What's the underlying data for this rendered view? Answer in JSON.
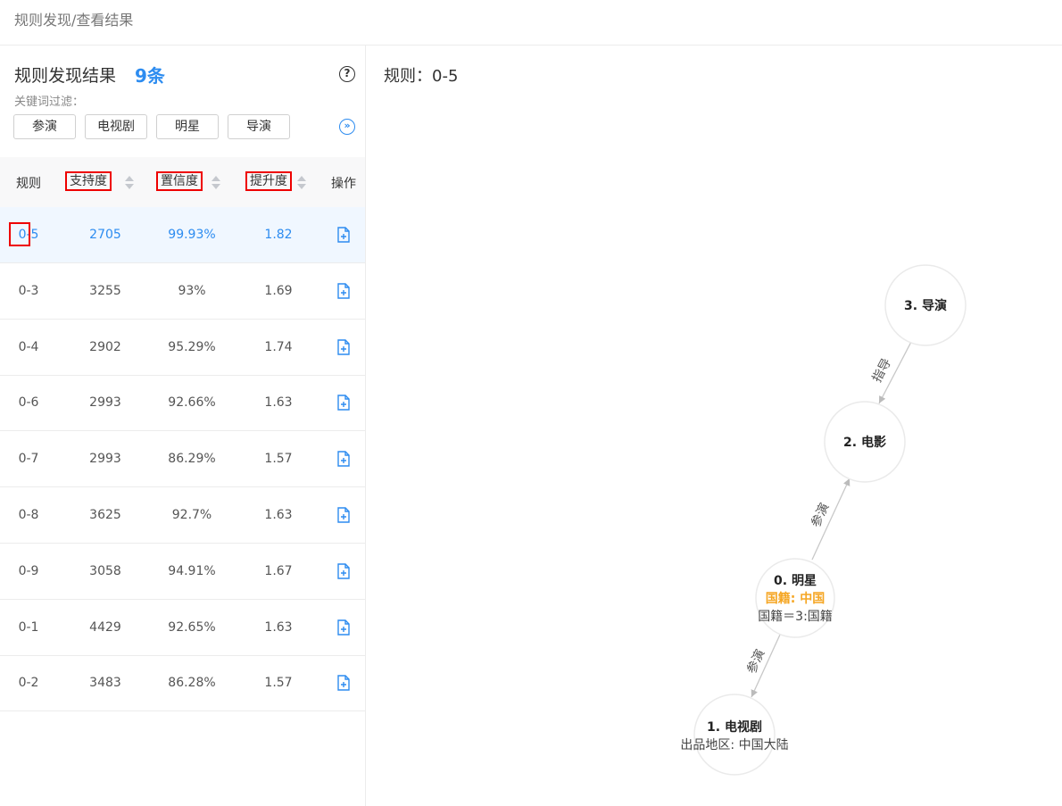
{
  "breadcrumb": "规则发现/查看结果",
  "left_panel": {
    "title": "规则发现结果",
    "count": "9条",
    "help_icon": "?",
    "filter_label": "关键词过滤：",
    "chips": [
      "参演",
      "电视剧",
      "明星",
      "导演"
    ],
    "expand_icon": "»"
  },
  "table": {
    "headers": {
      "rule": "规则",
      "support": "支持度",
      "confidence": "置信度",
      "lift": "提升度",
      "action": "操作"
    },
    "rows": [
      {
        "rule": "0-5",
        "support": "2705",
        "confidence": "99.93%",
        "lift": "1.82"
      },
      {
        "rule": "0-3",
        "support": "3255",
        "confidence": "93%",
        "lift": "1.69"
      },
      {
        "rule": "0-4",
        "support": "2902",
        "confidence": "95.29%",
        "lift": "1.74"
      },
      {
        "rule": "0-6",
        "support": "2993",
        "confidence": "92.66%",
        "lift": "1.63"
      },
      {
        "rule": "0-7",
        "support": "2993",
        "confidence": "86.29%",
        "lift": "1.57"
      },
      {
        "rule": "0-8",
        "support": "3625",
        "confidence": "92.7%",
        "lift": "1.63"
      },
      {
        "rule": "0-9",
        "support": "3058",
        "confidence": "94.91%",
        "lift": "1.67"
      },
      {
        "rule": "0-1",
        "support": "4429",
        "confidence": "92.65%",
        "lift": "1.63"
      },
      {
        "rule": "0-2",
        "support": "3483",
        "confidence": "86.28%",
        "lift": "1.57"
      }
    ]
  },
  "right_panel": {
    "title": "规则：0-5",
    "graph": {
      "nodes": {
        "n3": {
          "title": "3. 导演"
        },
        "n2": {
          "title": "2. 电影"
        },
        "n0": {
          "title": "0. 明星",
          "highlight": "国籍: 中国",
          "sub": "国籍＝3:国籍"
        },
        "n1": {
          "title": "1. 电视剧",
          "sub": "出品地区: 中国大陆"
        }
      },
      "edges": {
        "e32": "指导",
        "e02": "参演",
        "e01": "参演"
      }
    }
  },
  "colors": {
    "accent": "#2d8cf0",
    "highlight": "#f5a623",
    "mark": "#e00000"
  }
}
